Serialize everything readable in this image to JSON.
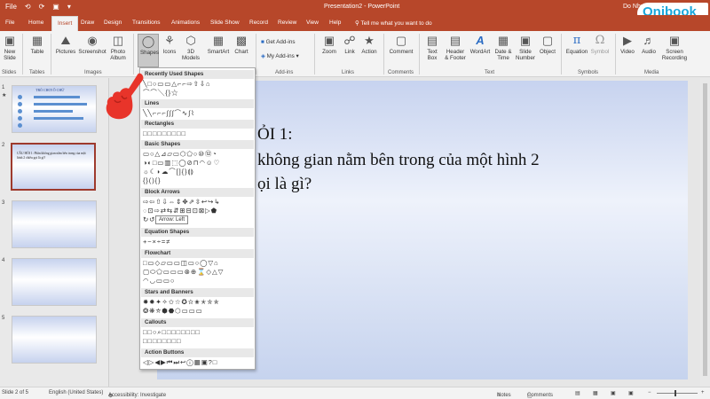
{
  "titlebar": {
    "qat": [
      "File",
      "⟲",
      "⟳",
      "▣",
      "▾"
    ],
    "title": "Presentation2 - PowerPoint",
    "user": "Do Nhu"
  },
  "logo": "Onibook",
  "tabs": [
    "File",
    "Home",
    "Insert",
    "Draw",
    "Design",
    "Transitions",
    "Animations",
    "Slide Show",
    "Record",
    "Review",
    "View",
    "Help"
  ],
  "active_tab": "Insert",
  "tellme": "Tell me what you want to do",
  "ribbon": {
    "new_slide": [
      "New",
      "Slide"
    ],
    "table": "Table",
    "pictures": "Pictures",
    "screenshot": "Screenshot",
    "photo_album": [
      "Photo",
      "Album"
    ],
    "shapes": "Shapes",
    "icons": "Icons",
    "models": [
      "3D",
      "Models"
    ],
    "smartart": "SmartArt",
    "chart": "Chart",
    "get_addins": "Get Add-ins",
    "my_addins": "My Add-ins",
    "zoom": "Zoom",
    "link": "Link",
    "action": "Action",
    "comment": "Comment",
    "text_box": [
      "Text",
      "Box"
    ],
    "header_footer": [
      "Header",
      "& Footer"
    ],
    "wordart": "WordArt",
    "date_time": [
      "Date &",
      "Time"
    ],
    "slide_number": [
      "Slide",
      "Number"
    ],
    "object": "Object",
    "equation": "Equation",
    "symbol": "Symbol",
    "video": "Video",
    "audio": "Audio",
    "screen_recording": [
      "Screen",
      "Recording"
    ],
    "groups": {
      "slides": "Slides",
      "tables": "Tables",
      "images": "Images",
      "addins": "Add-ins",
      "links": "Links",
      "comments": "Comments",
      "text": "Text",
      "symbols": "Symbols",
      "media": "Media"
    }
  },
  "thumbnails": {
    "numbers": [
      "1",
      "2",
      "3",
      "4",
      "5"
    ],
    "star": "★",
    "slide1_title": "TRÒ CHƠI Ô CHỮ",
    "slide2_text": "CÂU HỎI 1: Phần không gian nằm bên trong của một hình 2 chiều gọi là gì?"
  },
  "slide": {
    "line1": "ỎI 1:",
    "line2": "không gian nằm bên trong của một hình 2",
    "line3": "ọi là gì?"
  },
  "shapes_menu": {
    "categories": [
      "Recently Used Shapes",
      "Lines",
      "Rectangles",
      "Basic Shapes",
      "Block Arrows",
      "Equation Shapes",
      "Flowchart",
      "Stars and Banners",
      "Callouts",
      "Action Buttons"
    ],
    "rows": [
      "╲□○▭▭△⌐⌐⇨⇧⇩⌂",
      "⌒⌒╲{}☆",
      "╲╲⌐⌐⌐∫∫∫⌒∿∫⌇",
      "□□□□□□□□□",
      "▭○△⊿▱▭⬡⬠○⑩⑫◔",
      "◑◐□▭▥⬚◯⊘⊓◠☺♡",
      "☼☾◗☁⌒[]{}⟬⟭",
      "{}(){}",
      "⇨⇦⇧⇩⇔⇕✥⇗⇳↩↪↳",
      "◌⊡⇨⇄⇆⇵⊞⊟⊡⊠▷⬟",
      "↻↺↯⇆⇄⊏",
      "+−×÷=≠",
      "□▭◇▱▭▭◫▭○◯▽⌂",
      "▢⬭⬠▭▭▭⊗⊕⌛◇△▽",
      "◠◡▭▭○",
      "✸✹✦✧✩☆✪✫✬✭✮✯",
      "❂❋⛤⬢⬣⬡▭▭▭",
      "□□○⌕□□□□□□□□",
      "□□□□□□□□",
      "◁▷◀▶⏮⏭↩ⓘ▦▣?□"
    ]
  },
  "tooltip": "Arrow: Left",
  "statusbar": {
    "slide": "Slide 2 of 5",
    "language": "English (United States)",
    "accessibility": "Accessibility: Investigate",
    "notes": "Notes",
    "comments": "Comments"
  },
  "colors": {
    "accent": "#b7472a",
    "slide_bg": "#c7d3ef",
    "hand": "#e8342a"
  }
}
